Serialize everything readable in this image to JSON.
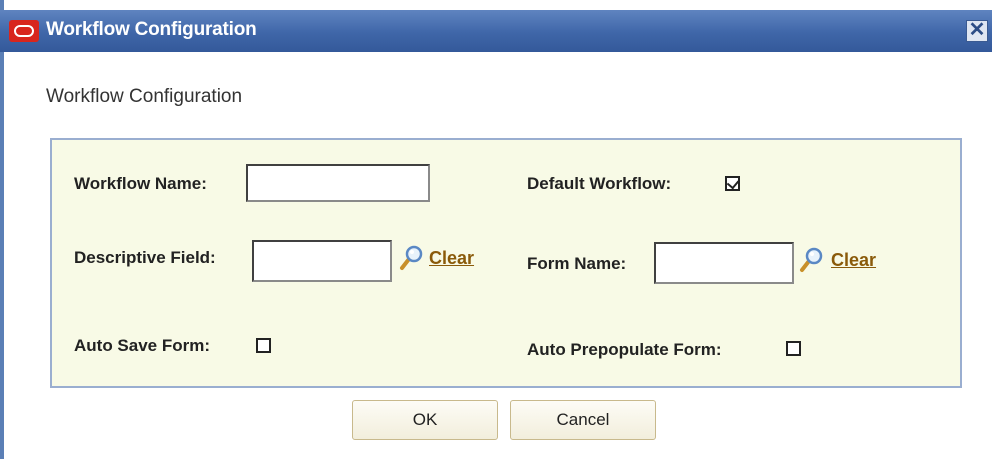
{
  "window": {
    "title": "Workflow Configuration",
    "close_symbol": "✕"
  },
  "heading": "Workflow Configuration",
  "form": {
    "workflow_name": {
      "label": "Workflow Name:",
      "value": ""
    },
    "default_workflow": {
      "label": "Default Workflow:",
      "checked": true
    },
    "descriptive_field": {
      "label": "Descriptive Field:",
      "value": "",
      "clear_label": "Clear"
    },
    "form_name": {
      "label": "Form Name:",
      "value": "",
      "clear_label": "Clear"
    },
    "auto_save_form": {
      "label": "Auto Save Form:",
      "checked": false
    },
    "auto_prepopulate_form": {
      "label": "Auto Prepopulate Form:",
      "checked": false
    }
  },
  "buttons": {
    "ok_label": "OK",
    "cancel_label": "Cancel"
  },
  "icons": {
    "logo": "oracle-logo-icon",
    "search": "magnifier-icon",
    "close": "close-icon"
  },
  "colors": {
    "titlebar": "#3f66a8",
    "panel_background": "#f8fae6",
    "panel_border": "#9aaed0",
    "link": "#8a5a0a"
  }
}
